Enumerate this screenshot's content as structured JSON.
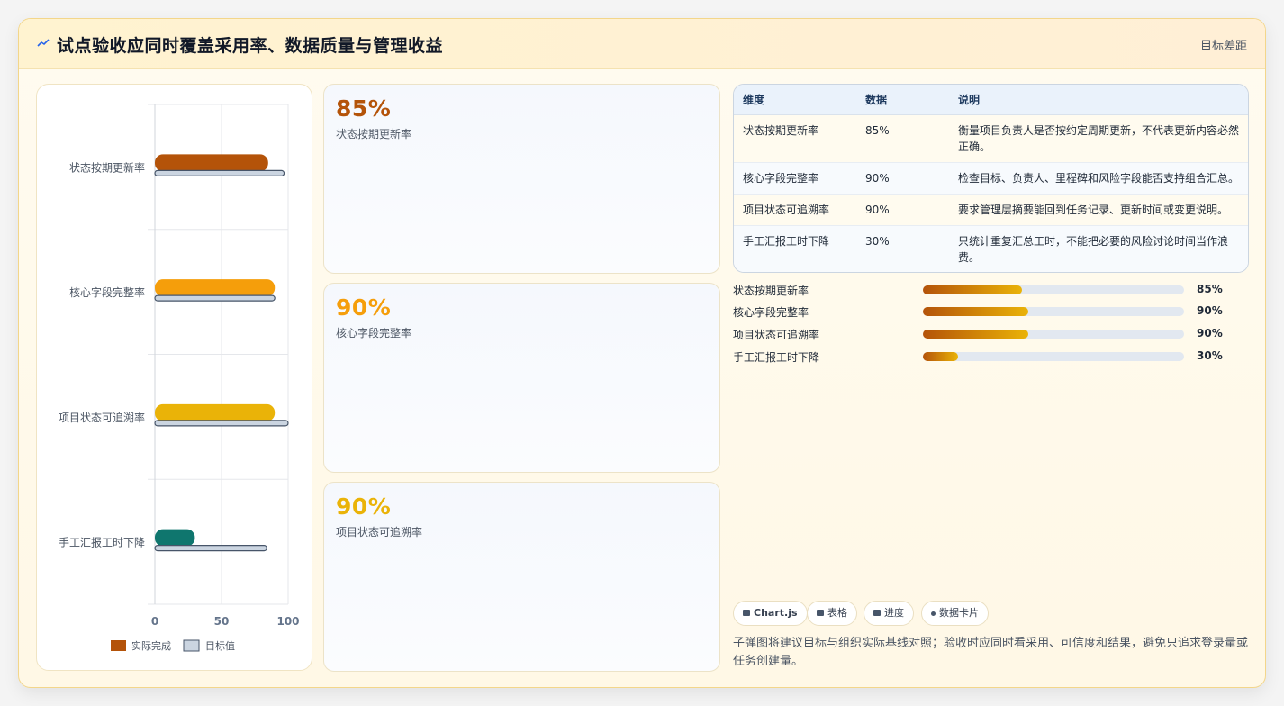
{
  "header": {
    "title": "试点验收应同时覆盖采用率、数据质量与管理收益",
    "right_label": "目标差距"
  },
  "chart_data": {
    "type": "bar",
    "orientation": "horizontal",
    "categories": [
      "状态按期更新率",
      "核心字段完整率",
      "项目状态可追溯率",
      "手工汇报工时下降"
    ],
    "series": [
      {
        "name": "实际完成",
        "values": [
          85,
          90,
          90,
          30
        ],
        "colors": [
          "#b45309",
          "#f59e0b",
          "#eab308",
          "#0f766e"
        ]
      },
      {
        "name": "目标值",
        "values": [
          97,
          90,
          100,
          84
        ],
        "color": "#cbd5e1"
      }
    ],
    "xlim": [
      0,
      100
    ],
    "xticks": [
      "0",
      "50",
      "100"
    ],
    "grid": true,
    "legend": "bottom"
  },
  "kpis": [
    {
      "value": "85%",
      "label": "状态按期更新率",
      "color": "#b45309"
    },
    {
      "value": "90%",
      "label": "核心字段完整率",
      "color": "#f59e0b"
    },
    {
      "value": "90%",
      "label": "项目状态可追溯率",
      "color": "#eab308"
    }
  ],
  "table": {
    "headers": [
      "维度",
      "数据",
      "说明"
    ],
    "rows": [
      [
        "状态按期更新率",
        "85%",
        "衡量项目负责人是否按约定周期更新，不代表更新内容必然正确。"
      ],
      [
        "核心字段完整率",
        "90%",
        "检查目标、负责人、里程碑和风险字段能否支持组合汇总。"
      ],
      [
        "项目状态可追溯率",
        "90%",
        "要求管理层摘要能回到任务记录、更新时间或变更说明。"
      ],
      [
        "手工汇报工时下降",
        "30%",
        "只统计重复汇总工时，不能把必要的风险讨论时间当作浪费。"
      ]
    ]
  },
  "progress": [
    {
      "label": "状态按期更新率",
      "value_text": "85%",
      "value": 0.38
    },
    {
      "label": "核心字段完整率",
      "value_text": "90%",
      "value": 0.405
    },
    {
      "label": "项目状态可追溯率",
      "value_text": "90%",
      "value": 0.405
    },
    {
      "label": "手工汇报工时下降",
      "value_text": "30%",
      "value": 0.135
    }
  ],
  "chips": [
    "Chart.js",
    "表格",
    "进度",
    "数据卡片"
  ],
  "footnote": "子弹图将建议目标与组织实际基线对照；验收时应同时看采用、可信度和结果，避免只追求登录量或任务创建量。"
}
